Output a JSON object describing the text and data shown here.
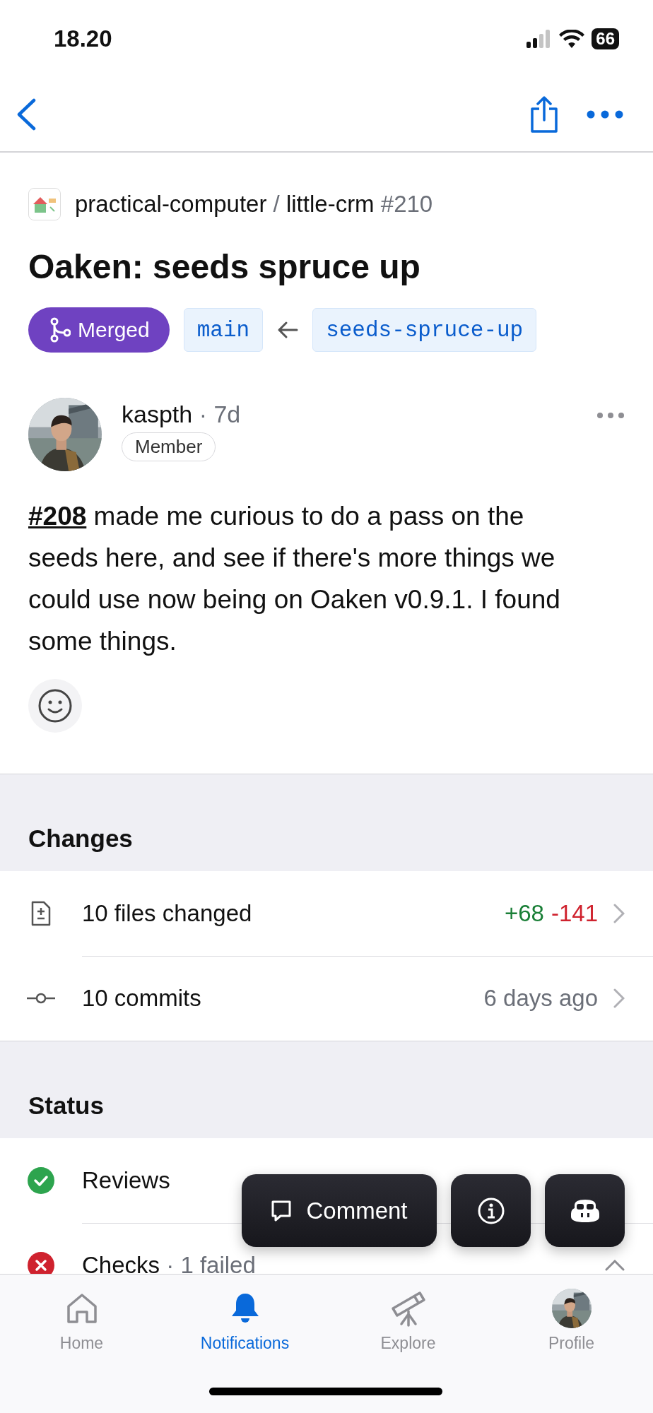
{
  "status_bar": {
    "time": "18.20",
    "battery": "66"
  },
  "repo": {
    "owner": "practical-computer",
    "separator": "/",
    "name": "little-crm",
    "number": "#210"
  },
  "title": "Oaken: seeds spruce up",
  "state_badge": {
    "label": "Merged",
    "kind": "merged"
  },
  "branches": {
    "base": "main",
    "head": "seeds-spruce-up"
  },
  "author": {
    "name": "kaspth",
    "separator": "·",
    "age": "7d",
    "role": "Member"
  },
  "body": {
    "link": "#208",
    "text": " made me curious to do a pass on the seeds here, and see if there's more things we could use now being on Oaken v0.9.1. I found some things."
  },
  "sections": [
    {
      "title": "Changes",
      "rows": [
        {
          "kind": "files",
          "label": "10 files changed",
          "additions": "+68",
          "deletions": "-141"
        },
        {
          "kind": "commits",
          "label": "10 commits",
          "meta": "6 days ago"
        }
      ]
    },
    {
      "title": "Status",
      "rows": [
        {
          "kind": "success",
          "label": "Reviews"
        },
        {
          "kind": "failure",
          "label": "Checks",
          "separator": "·",
          "meta": "1 failed"
        }
      ]
    }
  ],
  "actions": {
    "comment": "Comment"
  },
  "tabs": [
    {
      "kind": "home",
      "label": "Home",
      "selected": false
    },
    {
      "kind": "notifications",
      "label": "Notifications",
      "selected": true
    },
    {
      "kind": "explore",
      "label": "Explore",
      "selected": false
    },
    {
      "kind": "profile",
      "label": "Profile",
      "selected": false
    }
  ]
}
